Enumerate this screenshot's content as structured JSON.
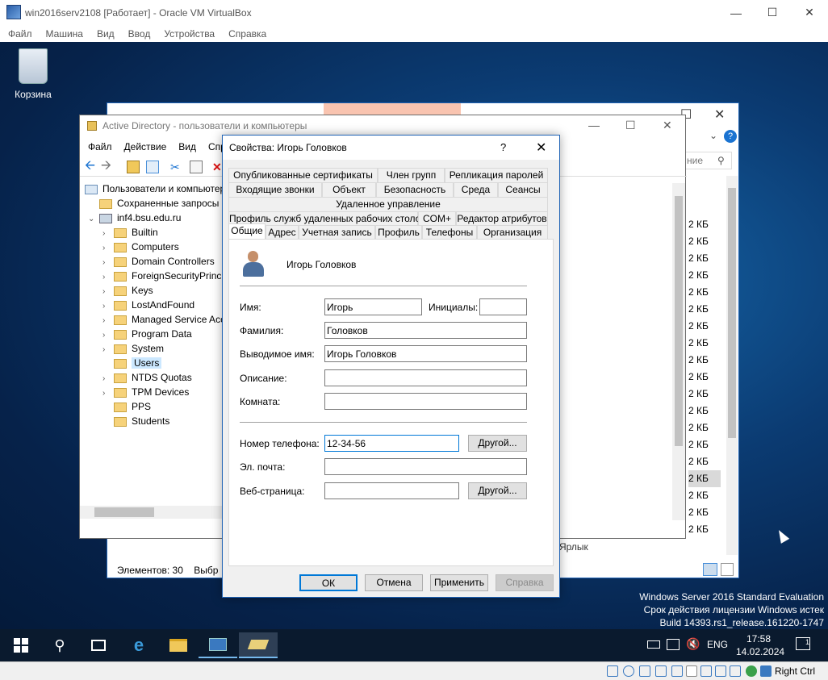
{
  "vbox": {
    "title": "win2016serv2108 [Работает] - Oracle VM VirtualBox",
    "menu": [
      "Файл",
      "Машина",
      "Вид",
      "Ввод",
      "Устройства",
      "Справка"
    ],
    "status_host_key": "Right Ctrl"
  },
  "desktop": {
    "recycle_bin": "Корзина",
    "watermark": [
      "Windows Server 2016 Standard Evaluation",
      "Срок действия лицензии Windows истек",
      "Build 14393.rs1_release.161220-1747"
    ]
  },
  "bg_window": {
    "search_placeholder": "ние",
    "sizes": [
      "2 КБ",
      "2 КБ",
      "2 КБ",
      "2 КБ",
      "2 КБ",
      "2 КБ",
      "2 КБ",
      "2 КБ",
      "2 КБ",
      "2 КБ",
      "2 КБ",
      "2 КБ",
      "2 КБ",
      "2 КБ",
      "2 КБ",
      "2 КБ",
      "2 КБ",
      "2 КБ",
      "2 КБ",
      "2 КБ"
    ],
    "label_shortcut": "Ярлык",
    "status": "Элементов: 30",
    "status2": "Выбр"
  },
  "ad": {
    "title": "Active Directory - пользователи и компьютеры",
    "menu": [
      "Файл",
      "Действие",
      "Вид",
      "Спр"
    ],
    "tree": [
      {
        "label": "Пользователи и компьютер",
        "level": 0,
        "chev": ""
      },
      {
        "label": "Сохраненные запросы",
        "level": 1,
        "chev": ""
      },
      {
        "label": "inf4.bsu.edu.ru",
        "level": 1,
        "chev": "⌄"
      },
      {
        "label": "Builtin",
        "level": 2,
        "chev": "›"
      },
      {
        "label": "Computers",
        "level": 2,
        "chev": "›"
      },
      {
        "label": "Domain Controllers",
        "level": 2,
        "chev": "›"
      },
      {
        "label": "ForeignSecurityPrinci",
        "level": 2,
        "chev": "›"
      },
      {
        "label": "Keys",
        "level": 2,
        "chev": "›"
      },
      {
        "label": "LostAndFound",
        "level": 2,
        "chev": "›"
      },
      {
        "label": "Managed Service Acco",
        "level": 2,
        "chev": "›"
      },
      {
        "label": "Program Data",
        "level": 2,
        "chev": "›"
      },
      {
        "label": "System",
        "level": 2,
        "chev": "›"
      },
      {
        "label": "Users",
        "level": 2,
        "chev": "",
        "selected": true
      },
      {
        "label": "NTDS Quotas",
        "level": 2,
        "chev": "›"
      },
      {
        "label": "TPM Devices",
        "level": 2,
        "chev": "›"
      },
      {
        "label": "PPS",
        "level": 2,
        "chev": ""
      },
      {
        "label": "Students",
        "level": 2,
        "chev": ""
      }
    ]
  },
  "dialog": {
    "title": "Свойства: Игорь Головков",
    "help": "?",
    "tabs_row1": [
      "Опубликованные сертификаты",
      "Член групп",
      "Репликация паролей"
    ],
    "tabs_row2": [
      "Входящие звонки",
      "Объект",
      "Безопасность",
      "Среда",
      "Сеансы"
    ],
    "tabs_row3": [
      "Удаленное управление"
    ],
    "tabs_row4": [
      "Профиль служб удаленных рабочих столов",
      "COM+",
      "Редактор атрибутов"
    ],
    "tabs_row5": [
      "Общие",
      "Адрес",
      "Учетная запись",
      "Профиль",
      "Телефоны",
      "Организация"
    ],
    "user_display": "Игорь Головков",
    "labels": {
      "first_name": "Имя:",
      "initials": "Инициалы:",
      "last_name": "Фамилия:",
      "display_name": "Выводимое имя:",
      "description": "Описание:",
      "office": "Комната:",
      "phone": "Номер телефона:",
      "email": "Эл. почта:",
      "web": "Веб-страница:"
    },
    "values": {
      "first_name": "Игорь",
      "initials": "",
      "last_name": "Головков",
      "display_name": "Игорь Головков",
      "description": "",
      "office": "",
      "phone": "12-34-56",
      "email": "",
      "web": ""
    },
    "other_button": "Другой...",
    "buttons": {
      "ok": "ОК",
      "cancel": "Отмена",
      "apply": "Применить",
      "help": "Справка"
    }
  },
  "taskbar": {
    "lang": "ENG",
    "time": "17:58",
    "date": "14.02.2024",
    "notif_count": "1"
  }
}
